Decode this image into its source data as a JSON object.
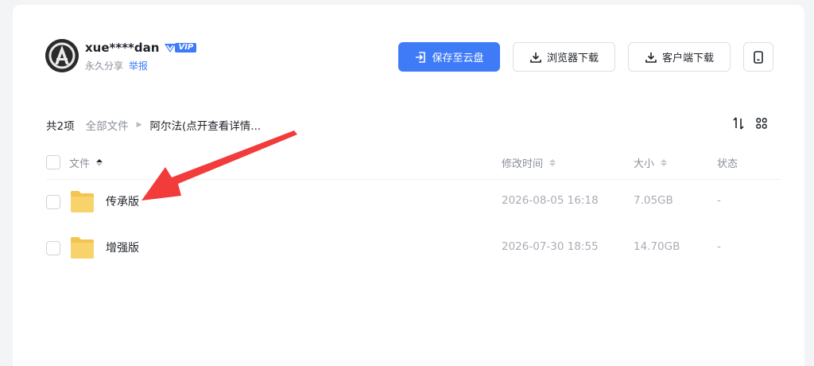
{
  "share": {
    "username": "xue****dan",
    "vip_label": "VIP",
    "permanent": "永久分享",
    "report": "举报"
  },
  "actions": {
    "save": "保存至云盘",
    "browser_download": "浏览器下载",
    "client_download": "客户端下载"
  },
  "breadcrumb": {
    "count": "共2项",
    "root": "全部文件",
    "current": "阿尔法(点开查看详情..."
  },
  "table": {
    "columns": {
      "name": "文件",
      "modified": "修改时间",
      "size": "大小",
      "status": "状态"
    },
    "rows": [
      {
        "name": "传承版",
        "modified": "2026-08-05 16:18",
        "size": "7.05GB",
        "status": "-"
      },
      {
        "name": "增强版",
        "modified": "2026-07-30 18:55",
        "size": "14.70GB",
        "status": "-"
      }
    ]
  },
  "colors": {
    "accent": "#3f7bf7",
    "arrow": "#f23b3b",
    "folder": "#f8d36b"
  },
  "icons": [
    "avatar",
    "vip-icon",
    "save-icon",
    "download-icon",
    "mobile-icon",
    "sort-icon",
    "grid-icon",
    "folder-icon",
    "arrow-annotation"
  ]
}
